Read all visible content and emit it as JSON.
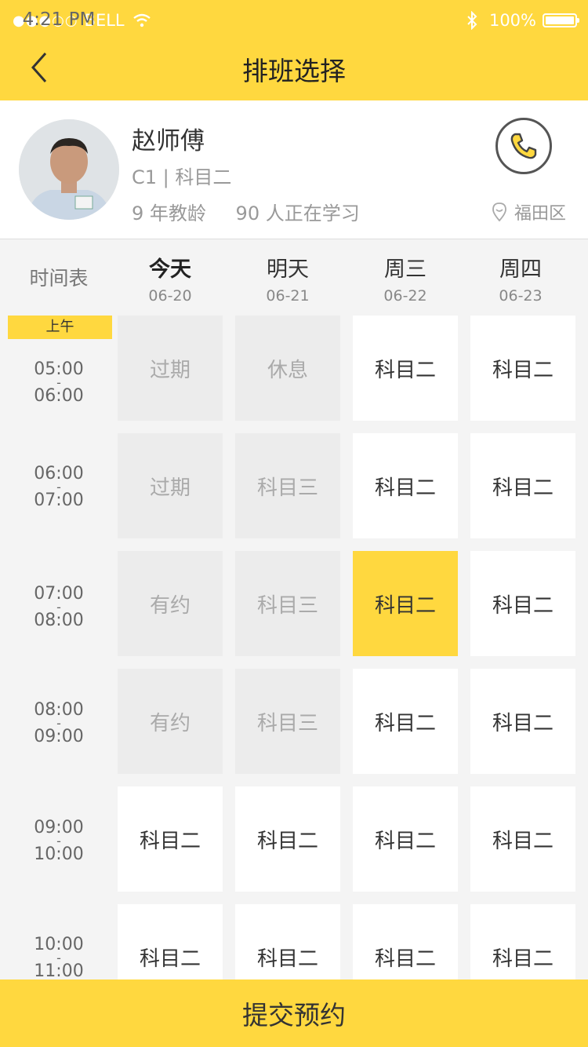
{
  "status_bar": {
    "signal": "●●●○○",
    "carrier": "BELL",
    "time": "4:21 PM",
    "battery": "100%"
  },
  "nav": {
    "title": "排班选择"
  },
  "coach": {
    "name": "赵师傅",
    "license": "C1 | 科目二",
    "experience": "9 年教龄",
    "students": "90 人正在学习",
    "district": "福田区"
  },
  "schedule": {
    "timetable_label": "时间表",
    "period_label": "上午",
    "days": [
      {
        "name": "今天",
        "date": "06-20"
      },
      {
        "name": "明天",
        "date": "06-21"
      },
      {
        "name": "周三",
        "date": "06-22"
      },
      {
        "name": "周四",
        "date": "06-23"
      }
    ],
    "rows": [
      {
        "start": "05:00",
        "end": "06:00",
        "cells": [
          "过期",
          "休息",
          "科目二",
          "科目二"
        ]
      },
      {
        "start": "06:00",
        "end": "07:00",
        "cells": [
          "过期",
          "科目三",
          "科目二",
          "科目二"
        ]
      },
      {
        "start": "07:00",
        "end": "08:00",
        "cells": [
          "有约",
          "科目三",
          "科目二",
          "科目二"
        ]
      },
      {
        "start": "08:00",
        "end": "09:00",
        "cells": [
          "有约",
          "科目三",
          "科目二",
          "科目二"
        ]
      },
      {
        "start": "09:00",
        "end": "10:00",
        "cells": [
          "科目二",
          "科目二",
          "科目二",
          "科目二"
        ]
      },
      {
        "start": "10:00",
        "end": "11:00",
        "cells": [
          "科目二",
          "科目二",
          "科目二",
          "科目二"
        ]
      }
    ],
    "cell_states": [
      [
        "past",
        "past",
        "avail",
        "avail"
      ],
      [
        "past",
        "past",
        "avail",
        "avail"
      ],
      [
        "past",
        "past",
        "selected",
        "avail"
      ],
      [
        "past",
        "past",
        "avail",
        "avail"
      ],
      [
        "avail",
        "avail",
        "avail",
        "avail"
      ],
      [
        "avail",
        "avail",
        "avail",
        "avail"
      ]
    ]
  },
  "submit_label": "提交预约",
  "colors": {
    "accent": "#ffd83f"
  }
}
